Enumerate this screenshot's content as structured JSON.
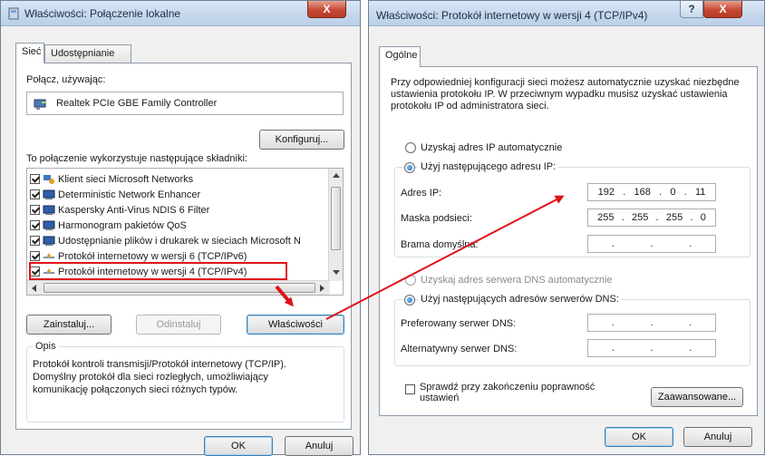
{
  "left_window": {
    "title": "Właściwości: Połączenie lokalne",
    "close": "X",
    "tabs": [
      "Sieć",
      "Udostępnianie"
    ],
    "connect_label": "Połącz, używając:",
    "adapter": "Realtek PCIe GBE Family Controller",
    "configure_button": "Konfiguruj...",
    "components_label": "To połączenie wykorzystuje następujące składniki:",
    "components": [
      {
        "label": "Klient sieci Microsoft Networks",
        "checked": true,
        "icon": "network-client-icon"
      },
      {
        "label": "Deterministic Network Enhancer",
        "checked": true,
        "icon": "network-service-icon"
      },
      {
        "label": "Kaspersky Anti-Virus NDIS 6 Filter",
        "checked": true,
        "icon": "network-service-icon"
      },
      {
        "label": "Harmonogram pakietów QoS",
        "checked": true,
        "icon": "network-service-icon"
      },
      {
        "label": "Udostępnianie plików i drukarek w sieciach Microsoft N",
        "checked": true,
        "icon": "network-service-icon"
      },
      {
        "label": "Protokół internetowy w wersji 6 (TCP/IPv6)",
        "checked": true,
        "icon": "protocol-icon"
      },
      {
        "label": "Protokół internetowy w wersji 4 (TCP/IPv4)",
        "checked": true,
        "icon": "protocol-icon"
      }
    ],
    "install_button": "Zainstaluj...",
    "uninstall_button": "Odinstaluj",
    "properties_button": "Właściwości",
    "description_title": "Opis",
    "description": "Protokół kontroli transmisji/Protokół internetowy (TCP/IP). Domyślny protokół dla sieci rozległych, umożliwiający komunikację połączonych sieci różnych typów.",
    "ok_button": "OK",
    "cancel_button": "Anuluj"
  },
  "right_window": {
    "title": "Właściwości: Protokół internetowy w wersji 4 (TCP/IPv4)",
    "help": "?",
    "close": "X",
    "tab": "Ogólne",
    "intro": "Przy odpowiedniej konfiguracji sieci możesz automatycznie uzyskać niezbędne ustawienia protokołu IP. W przeciwnym wypadku musisz uzyskać ustawienia protokołu IP od administratora sieci.",
    "auto_ip": "Uzyskaj adres IP automatycznie",
    "manual_ip": "Użyj następującego adresu IP:",
    "ip_label": "Adres IP:",
    "ip_value": [
      "192",
      "168",
      "0",
      "11"
    ],
    "mask_label": "Maska podsieci:",
    "mask_value": [
      "255",
      "255",
      "255",
      "0"
    ],
    "gateway_label": "Brama domyślna:",
    "gateway_value": [
      "",
      "",
      "",
      ""
    ],
    "auto_dns": "Uzyskaj adres serwera DNS automatycznie",
    "manual_dns": "Użyj następujących adresów serwerów DNS:",
    "pref_dns_label": "Preferowany serwer DNS:",
    "alt_dns_label": "Alternatywny serwer DNS:",
    "validate_label": "Sprawdź przy zakończeniu poprawność ustawień",
    "advanced_button": "Zaawansowane...",
    "ok_button": "OK",
    "cancel_button": "Anuluj"
  },
  "colors": {
    "annotation_red": "#e0121b",
    "title_blue": "#c4d6ec"
  }
}
